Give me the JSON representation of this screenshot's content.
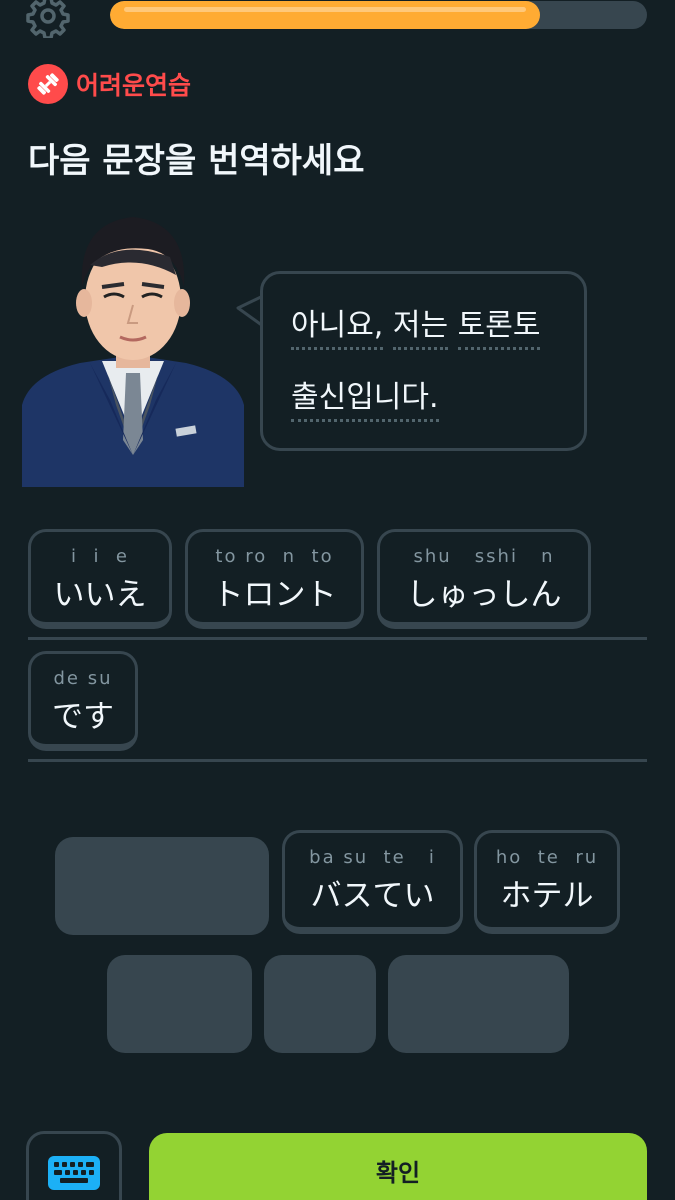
{
  "progress": {
    "value": 0.8
  },
  "badge": {
    "label": "어려운연습",
    "color": "#ff4b4b",
    "icon": "dumbbell-icon"
  },
  "title": "다음 문장을 번역하세요",
  "prompt": {
    "line1": [
      "아니요,",
      "저는",
      "토론토"
    ],
    "line2": [
      "출신입니다."
    ]
  },
  "answer": [
    {
      "romaji": "i  i  e",
      "kana": "いいえ"
    },
    {
      "romaji": "to ro  n  to",
      "kana": "トロント"
    },
    {
      "romaji": "shu   sshi   n",
      "kana": "しゅっしん"
    },
    {
      "romaji": "de su",
      "kana": "です"
    }
  ],
  "bank": [
    {
      "romaji": "ba su  te   i",
      "kana": "バスてい"
    },
    {
      "romaji": "ho  te  ru",
      "kana": "ホテル"
    }
  ],
  "icons": {
    "settings": "gear-icon",
    "keyboard": "keyboard-icon"
  },
  "colors": {
    "accent": "#93d333",
    "progress": "#ffab33",
    "background": "#131f24"
  },
  "buttons": {
    "check": "확인"
  }
}
